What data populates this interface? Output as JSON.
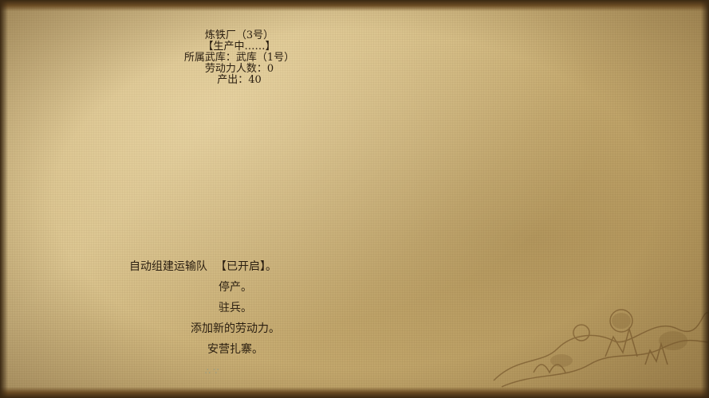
{
  "building": {
    "name": "炼铁厂（3号）",
    "status": "【生产中……】",
    "armory_line": "所属武库：武库（1号）",
    "labor_line": "劳动力人数：0",
    "output_line": "产出：40"
  },
  "menu": {
    "auto_transport_label": "自动组建运输队",
    "auto_transport_status": "【已开启】",
    "auto_transport_suffix": "。",
    "stop_production": "停产。",
    "garrison": "驻兵。",
    "add_labor": "添加新的劳动力。",
    "make_camp": "安营扎寨。"
  },
  "colors": {
    "text": "#2a1e10",
    "paper": "#cdb47c",
    "border": "#3a2812"
  }
}
